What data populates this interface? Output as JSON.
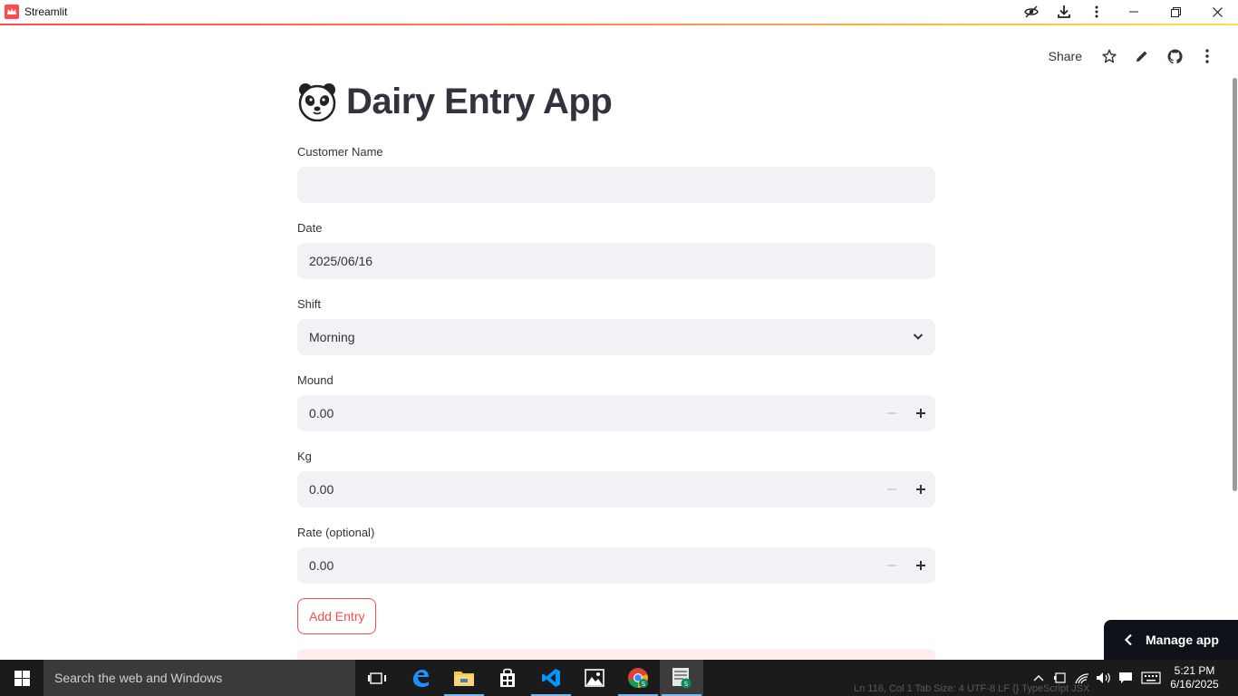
{
  "window": {
    "title": "Streamlit"
  },
  "toolbar": {
    "share_label": "Share"
  },
  "page": {
    "title": "Dairy Entry App"
  },
  "form": {
    "customer_name": {
      "label": "Customer Name",
      "value": ""
    },
    "date": {
      "label": "Date",
      "value": "2025/06/16"
    },
    "shift": {
      "label": "Shift",
      "value": "Morning"
    },
    "mound": {
      "label": "Mound",
      "value": "0.00"
    },
    "kg": {
      "label": "Kg",
      "value": "0.00"
    },
    "rate": {
      "label": "Rate (optional)",
      "value": "0.00"
    },
    "submit_label": "Add Entry"
  },
  "manage_app": {
    "label": "Manage app"
  },
  "taskbar": {
    "search_placeholder": "Search the web and Windows",
    "status_text": "Ln 116, Col 1   Tab Size: 4   UTF-8   LF   {}  TypeScript JSX",
    "clock_time": "5:21 PM",
    "clock_date": "6/16/2025"
  },
  "colors": {
    "accent": "#ff4b4b",
    "input_bg": "#f0f2f6",
    "text": "#31333f",
    "taskbar": "#1b1b1b"
  }
}
